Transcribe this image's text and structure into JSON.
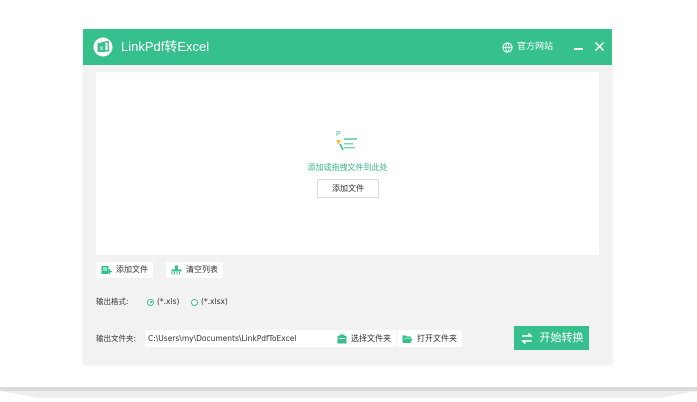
{
  "window": {
    "title": "LinkPdf转Excel",
    "official_site": "官方网站"
  },
  "drop_zone": {
    "doc_icon_letter": "P",
    "hint": "添加或拖拽文件到此处",
    "add_file_button": "添加文件"
  },
  "toolbar": {
    "add_file": "添加文件",
    "clear_list": "清空列表"
  },
  "output_format": {
    "label": "输出格式:",
    "options": [
      {
        "label": "(*.xls)",
        "selected": true
      },
      {
        "label": "(*.xlsx)",
        "selected": false
      }
    ]
  },
  "output_folder": {
    "label": "输出文件夹:",
    "path": "C:\\Users\\my\\Documents\\LinkPdfToExcel",
    "select_folder": "选择文件夹",
    "open_folder": "打开文件夹"
  },
  "start_button": "开始转换",
  "colors": {
    "accent": "#35c08d",
    "window_bg": "#f2f2f2"
  }
}
